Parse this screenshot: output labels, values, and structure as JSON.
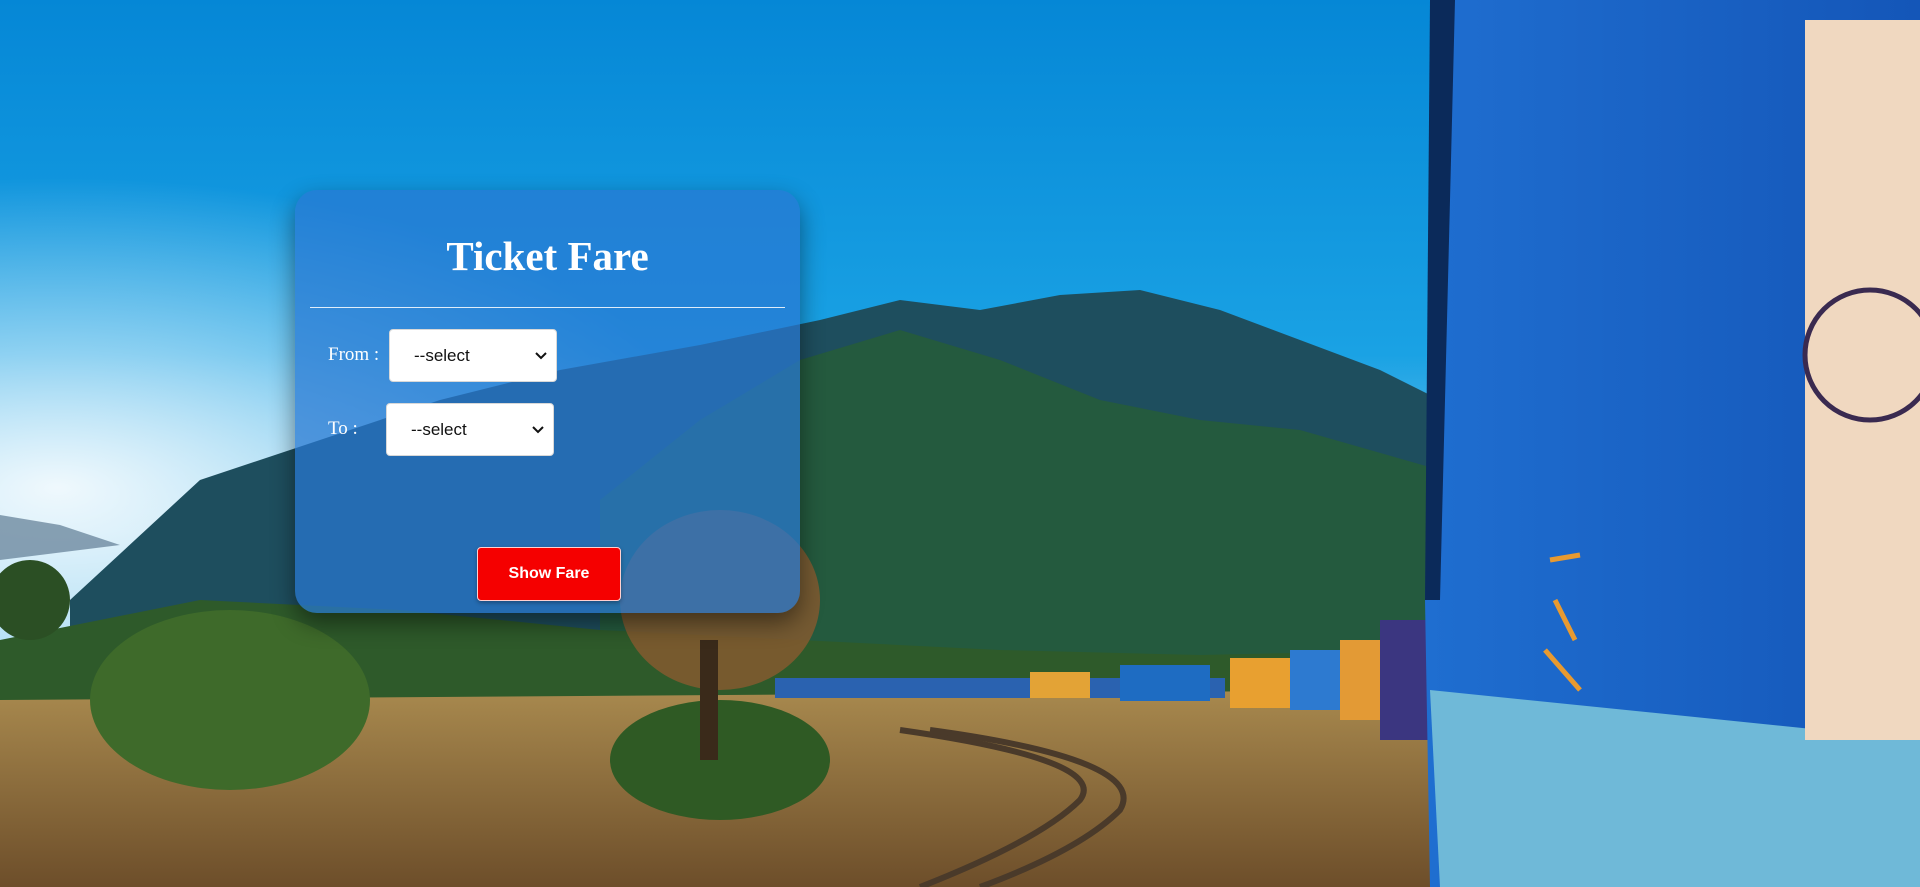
{
  "form": {
    "title": "Ticket Fare",
    "from_label": "From :",
    "from_selected": "--select",
    "to_label": "To :",
    "to_selected": "--select",
    "submit_label": "Show Fare"
  },
  "colors": {
    "card_background": "#2878d2",
    "button_background": "#f50000",
    "text": "#ffffff"
  },
  "icons": {
    "select_arrow": "chevron-down-icon"
  }
}
